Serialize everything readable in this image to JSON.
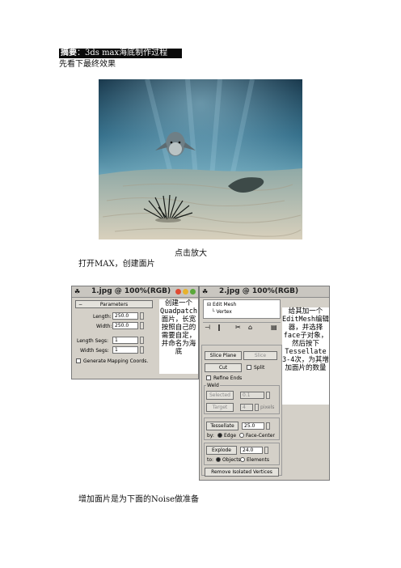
{
  "header": {
    "label": "摘要",
    "title": "：3ds max海底制作过程"
  },
  "intro_text": "先看下最终效果",
  "caption_zoom": "点击放大",
  "step1_text": "打开MAX，创建面片",
  "step2_text": "增加面片是为下面的Noise做准备",
  "window_left": {
    "title": "1.jpg @ 100%(RGB)",
    "rollout": "Parameters",
    "fields": [
      {
        "label": "Length:",
        "value": "250.0"
      },
      {
        "label": "Width:",
        "value": "250.0"
      },
      {
        "label": "Length Segs:",
        "value": "1"
      },
      {
        "label": "Width Segs:",
        "value": "1"
      }
    ],
    "checkbox_label": "Generate Mapping Coords.",
    "note": "创建一个Quadpatch面片，长宽按照自己的需要自定，并命名为海底"
  },
  "window_right": {
    "title": "2.jpg @ 100%(RGB)",
    "tree": [
      "Edit Mesh",
      "Vertex"
    ],
    "buttons": {
      "slice_plane": "Slice Plane",
      "slice": "Slice",
      "cut": "Cut",
      "split": "Split",
      "refine_ends": "Refine Ends",
      "weld": "Weld",
      "selected": "Selected",
      "selected_val": "0.1",
      "target": "Target",
      "target_val": "4",
      "pixels": "pixels",
      "tessellate": "Tessellate",
      "tess_val": "25.0",
      "by": "by:",
      "edge": "Edge",
      "face_center": "Face-Center",
      "explode": "Explode",
      "explode_val": "24.0",
      "to": "to:",
      "objects": "Objects",
      "elements": "Elements",
      "remove_isolated": "Remove Isolated Vertices"
    },
    "note": "给其加一个EditMesh编辑器，并选择face子对象，然后按下Tessellate 3-4次，为其增加面片的数量"
  },
  "colors": {
    "title_bar": "#c9c6c0",
    "panel": "#d4d0c8",
    "water_deep": "#0d2a3c",
    "water_light": "#4f8fae",
    "sand": "#c9c2ad"
  }
}
